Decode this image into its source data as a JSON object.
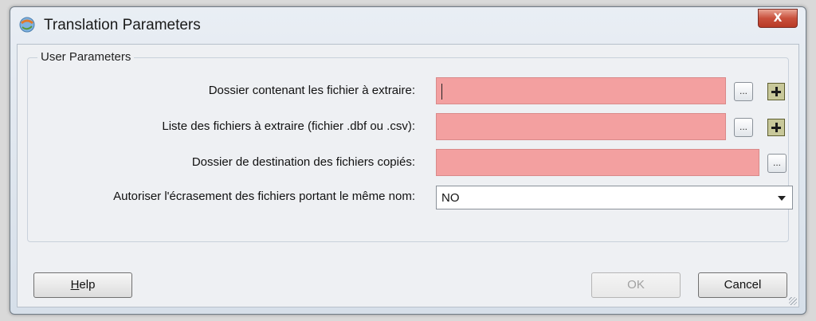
{
  "window": {
    "title": "Translation Parameters",
    "close_label": "X"
  },
  "group": {
    "label": "User Parameters"
  },
  "params": [
    {
      "label": "Dossier contenant les fichier à extraire:",
      "value": ""
    },
    {
      "label": "Liste des fichiers à extraire (fichier .dbf ou .csv):",
      "value": ""
    },
    {
      "label": "Dossier de destination des fichiers copiés:",
      "value": ""
    },
    {
      "label": "Autoriser l'écrasement des fichiers portant le même nom:",
      "value": "NO"
    }
  ],
  "browse_label": "...",
  "buttons": {
    "help": "Help",
    "ok": "OK",
    "cancel": "Cancel"
  },
  "colors": {
    "required_field": "#f3a0a0",
    "close_button": "#c9503c"
  }
}
